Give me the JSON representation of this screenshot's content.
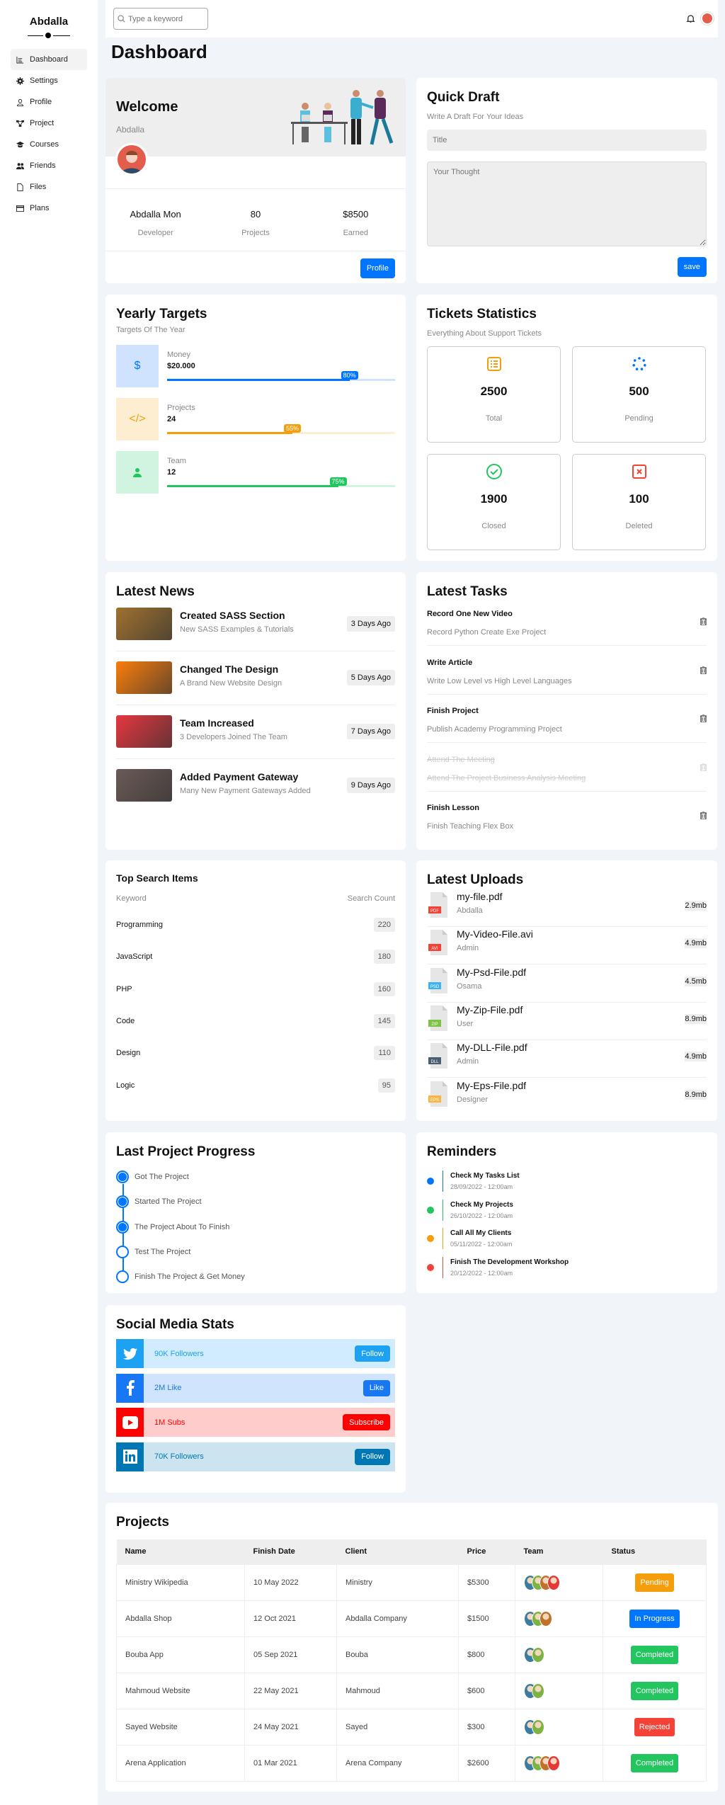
{
  "sidebar": {
    "brand": "Abdalla",
    "items": [
      {
        "label": "Dashboard",
        "icon": "chart-icon",
        "active": true
      },
      {
        "label": "Settings",
        "icon": "gear-icon"
      },
      {
        "label": "Profile",
        "icon": "user-icon"
      },
      {
        "label": "Project",
        "icon": "diagram-icon"
      },
      {
        "label": "Courses",
        "icon": "graduation-cap-icon"
      },
      {
        "label": "Friends",
        "icon": "users-icon"
      },
      {
        "label": "Files",
        "icon": "file-icon"
      },
      {
        "label": "Plans",
        "icon": "credit-card-icon"
      }
    ]
  },
  "topbar": {
    "search_placeholder": "Type a keyword"
  },
  "page_title": "Dashboard",
  "welcome": {
    "title": "Welcome",
    "name": "Abdalla",
    "stats": [
      {
        "value": "Abdalla Mon",
        "label": "Developer"
      },
      {
        "value": "80",
        "label": "Projects"
      },
      {
        "value": "$8500",
        "label": "Earned"
      }
    ],
    "button": "Profile"
  },
  "draft": {
    "title": "Quick Draft",
    "subtitle": "Write A Draft For Your Ideas",
    "title_placeholder": "Title",
    "text_placeholder": "Your Thought",
    "save": "save"
  },
  "targets": {
    "title": "Yearly Targets",
    "subtitle": "Targets Of The Year",
    "items": [
      {
        "label": "Money",
        "value": "$20.000",
        "percent": 80,
        "percent_label": "80%",
        "symbol": "$",
        "color": "#0075ff",
        "bg": "#cfe3ff"
      },
      {
        "label": "Projects",
        "value": "24",
        "percent": 55,
        "percent_label": "55%",
        "symbol": "</>",
        "color": "#f59e0b",
        "bg": "#fdeed1"
      },
      {
        "label": "Team",
        "value": "12",
        "percent": 75,
        "percent_label": "75%",
        "symbol": "person",
        "color": "#22c55e",
        "bg": "#d1f4e0"
      }
    ]
  },
  "tickets": {
    "title": "Tickets Statistics",
    "subtitle": "Everything About Support Tickets",
    "items": [
      {
        "value": "2500",
        "label": "Total",
        "icon": "list-icon",
        "color": "#f59e0b"
      },
      {
        "value": "500",
        "label": "Pending",
        "icon": "spinner-icon",
        "color": "#0075ff"
      },
      {
        "value": "1900",
        "label": "Closed",
        "icon": "check-circle-icon",
        "color": "#22c55e"
      },
      {
        "value": "100",
        "label": "Deleted",
        "icon": "x-square-icon",
        "color": "#f44336"
      }
    ]
  },
  "news": {
    "title": "Latest News",
    "items": [
      {
        "title": "Created SASS Section",
        "desc": "New SASS Examples & Tutorials",
        "time": "3 Days Ago",
        "color": "#a0712f"
      },
      {
        "title": "Changed The Design",
        "desc": "A Brand New Website Design",
        "time": "5 Days Ago",
        "color": "#f97d0c"
      },
      {
        "title": "Team Increased",
        "desc": "3 Developers Joined The Team",
        "time": "7 Days Ago",
        "color": "#e6363f"
      },
      {
        "title": "Added Payment Gateway",
        "desc": "Many New Payment Gateways Added",
        "time": "9 Days Ago",
        "color": "#6b5a57"
      }
    ]
  },
  "tasks": {
    "title": "Latest Tasks",
    "items": [
      {
        "title": "Record One New Video",
        "desc": "Record Python Create Exe Project",
        "done": false
      },
      {
        "title": "Write Article",
        "desc": "Write Low Level vs High Level Languages",
        "done": false
      },
      {
        "title": "Finish Project",
        "desc": "Publish Academy Programming Project",
        "done": false
      },
      {
        "title": "Attend The Meeting",
        "desc": "Attend The Project Business Analysis Meeting",
        "done": true
      },
      {
        "title": "Finish Lesson",
        "desc": "Finish Teaching Flex Box",
        "done": false
      }
    ]
  },
  "search": {
    "title": "Top Search Items",
    "col_keyword": "Keyword",
    "col_count": "Search Count",
    "items": [
      {
        "keyword": "Programming",
        "count": "220"
      },
      {
        "keyword": "JavaScript",
        "count": "180"
      },
      {
        "keyword": "PHP",
        "count": "160"
      },
      {
        "keyword": "Code",
        "count": "145"
      },
      {
        "keyword": "Design",
        "count": "110"
      },
      {
        "keyword": "Logic",
        "count": "95"
      }
    ]
  },
  "uploads": {
    "title": "Latest Uploads",
    "items": [
      {
        "name": "my-file.pdf",
        "by": "Abdalla",
        "size": "2.9mb",
        "type": "PDF",
        "color": "#f44336"
      },
      {
        "name": "My-Video-File.avi",
        "by": "Admin",
        "size": "4.9mb",
        "type": "AVI",
        "color": "#f44336"
      },
      {
        "name": "My-Psd-File.pdf",
        "by": "Osama",
        "size": "4.5mb",
        "type": "PSD",
        "color": "#3ab4f2"
      },
      {
        "name": "My-Zip-File.pdf",
        "by": "User",
        "size": "8.9mb",
        "type": "ZIP",
        "color": "#7dc242"
      },
      {
        "name": "My-DLL-File.pdf",
        "by": "Admin",
        "size": "4.9mb",
        "type": "DLL",
        "color": "#4b5d73"
      },
      {
        "name": "My-Eps-File.pdf",
        "by": "Designer",
        "size": "8.9mb",
        "type": "EPS",
        "color": "#f9b541"
      }
    ]
  },
  "progress": {
    "title": "Last Project Progress",
    "steps": [
      {
        "label": "Got The Project",
        "done": true
      },
      {
        "label": "Started The Project",
        "done": true
      },
      {
        "label": "The Project About To Finish",
        "done": true
      },
      {
        "label": "Test The Project",
        "done": false
      },
      {
        "label": "Finish The Project & Get Money",
        "done": false
      }
    ]
  },
  "reminders": {
    "title": "Reminders",
    "items": [
      {
        "title": "Check My Tasks List",
        "date": "28/09/2022 - 12:00am",
        "color": "#0075ff"
      },
      {
        "title": "Check My Projects",
        "date": "26/10/2022 - 12:00am",
        "color": "#22c55e"
      },
      {
        "title": "Call All My Clients",
        "date": "05/11/2022 - 12:00am",
        "color": "#f59e0b"
      },
      {
        "title": "Finish The Development Workshop",
        "date": "20/12/2022 - 12:00am",
        "color": "#f44336"
      }
    ]
  },
  "social": {
    "title": "Social Media Stats",
    "items": [
      {
        "network": "twitter",
        "text": "90K Followers",
        "button": "Follow",
        "color": "#1da1f2",
        "bg": "#d1ecfd"
      },
      {
        "network": "facebook",
        "text": "2M Like",
        "button": "Like",
        "color": "#1877f2",
        "bg": "#d1e4fd"
      },
      {
        "network": "youtube",
        "text": "1M Subs",
        "button": "Subscribe",
        "color": "#ff0000",
        "bg": "#ffcccc"
      },
      {
        "network": "linkedin",
        "text": "70K Followers",
        "button": "Follow",
        "color": "#0077b5",
        "bg": "#cce4f0"
      }
    ]
  },
  "projects": {
    "title": "Projects",
    "columns": [
      "Name",
      "Finish Date",
      "Client",
      "Price",
      "Team",
      "Status"
    ],
    "rows": [
      {
        "name": "Ministry Wikipedia",
        "date": "10 May 2022",
        "client": "Ministry",
        "price": "$5300",
        "team": 4,
        "status": "Pending",
        "status_color": "#f59e0b"
      },
      {
        "name": "Abdalla Shop",
        "date": "12 Oct 2021",
        "client": "Abdalla Company",
        "price": "$1500",
        "team": 3,
        "status": "In Progress",
        "status_color": "#0075ff"
      },
      {
        "name": "Bouba App",
        "date": "05 Sep 2021",
        "client": "Bouba",
        "price": "$800",
        "team": 2,
        "status": "Completed",
        "status_color": "#22c55e"
      },
      {
        "name": "Mahmoud Website",
        "date": "22 May 2021",
        "client": "Mahmoud",
        "price": "$600",
        "team": 2,
        "status": "Completed",
        "status_color": "#22c55e"
      },
      {
        "name": "Sayed Website",
        "date": "24 May 2021",
        "client": "Sayed",
        "price": "$300",
        "team": 2,
        "status": "Rejected",
        "status_color": "#f44336"
      },
      {
        "name": "Arena Application",
        "date": "01 Mar 2021",
        "client": "Arena Company",
        "price": "$2600",
        "team": 4,
        "status": "Completed",
        "status_color": "#22c55e"
      }
    ]
  }
}
